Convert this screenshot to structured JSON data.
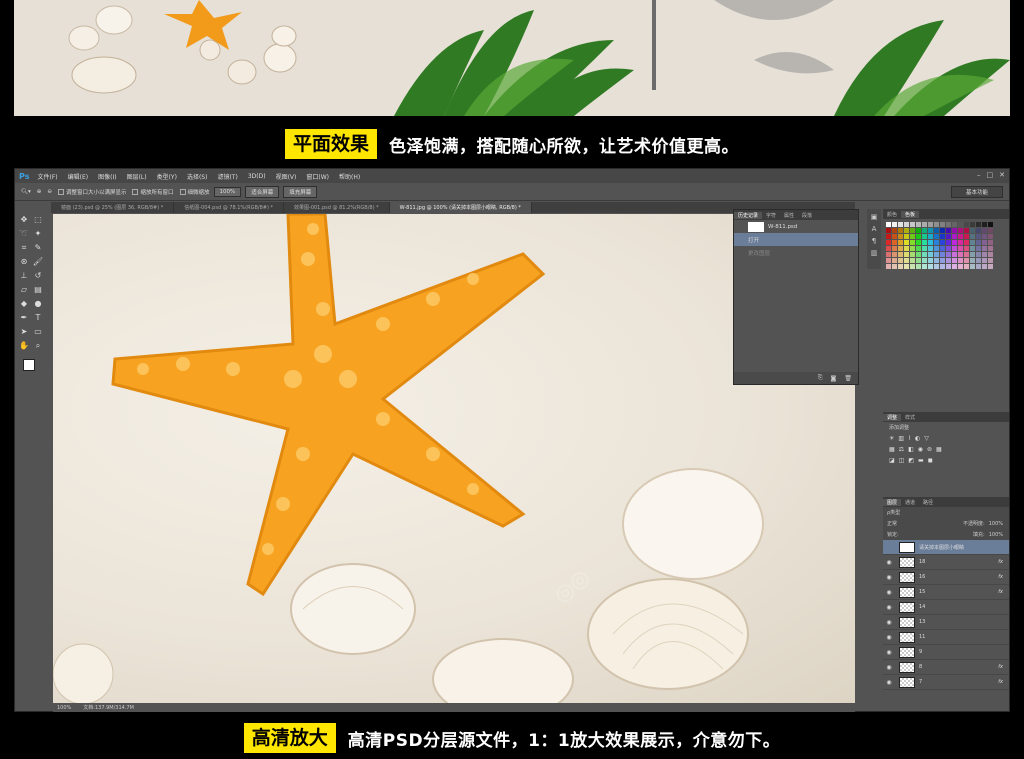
{
  "top_tagline": {
    "label": "平面效果",
    "text": "色泽饱满，搭配随心所欲，让艺术价值更高。"
  },
  "bottom_tagline": {
    "label": "高清放大",
    "text": "高清PSD分层源文件，1：1放大效果展示，介意勿下。"
  },
  "ps": {
    "logo": "Ps",
    "menu": [
      "文件(F)",
      "编辑(E)",
      "图像(I)",
      "图层(L)",
      "类型(Y)",
      "选择(S)",
      "滤镜(T)",
      "3D(D)",
      "视图(V)",
      "窗口(W)",
      "帮助(H)"
    ],
    "options": {
      "opt1": "调整窗口大小以满屏显示",
      "opt2": "缩放所有窗口",
      "opt3": "细微缩放",
      "zoom_btn": "100%",
      "fit_btn": "适合屏幕",
      "fill_btn": "填充屏幕"
    },
    "workspace": "基本功能",
    "tabs": [
      "镜面 (23).psd @ 25% (图层 36, RGB/8#) *",
      "信纸图-004.psd @ 78.1%(RGB/8#) *",
      "效果图-001.psd @ 81.2%(RGB/8) *",
      "W-811.jpg @ 100% (请关掉本图层小眼睛, RGB/8) *"
    ],
    "status": {
      "zoom": "100%",
      "doc": "文档:137.9M/314.7M"
    },
    "history": {
      "tabs": [
        "历史记录",
        "字符",
        "属性",
        "段落"
      ],
      "file": "W-811.psd",
      "row1": "打开",
      "row2": "更改图层"
    },
    "swatches_tabs": [
      "颜色",
      "色板"
    ],
    "adjust_tabs": [
      "调整",
      "样式"
    ],
    "adjust_title": "添加调整",
    "layers_tabs": [
      "图层",
      "通道",
      "路径"
    ],
    "layers_kind": "ρ类型",
    "blend_mode": "正常",
    "opacity_label": "不透明度:",
    "opacity": "100%",
    "lock_label": "锁定:",
    "fill_label": "填充:",
    "fill": "100%",
    "layers": [
      {
        "name": "请关掉本图层小眼睛",
        "fx": ""
      },
      {
        "name": "18",
        "fx": "fx"
      },
      {
        "name": "16",
        "fx": "fx"
      },
      {
        "name": "15",
        "fx": "fx"
      },
      {
        "name": "14",
        "fx": ""
      },
      {
        "name": "13",
        "fx": ""
      },
      {
        "name": "11",
        "fx": ""
      },
      {
        "name": "9",
        "fx": ""
      },
      {
        "name": "8",
        "fx": "fx"
      },
      {
        "name": "7",
        "fx": "fx"
      }
    ]
  },
  "colors": {
    "accent_yellow": "#ffe600",
    "starfish": "#f5a623",
    "sand": "#ece5d9"
  }
}
